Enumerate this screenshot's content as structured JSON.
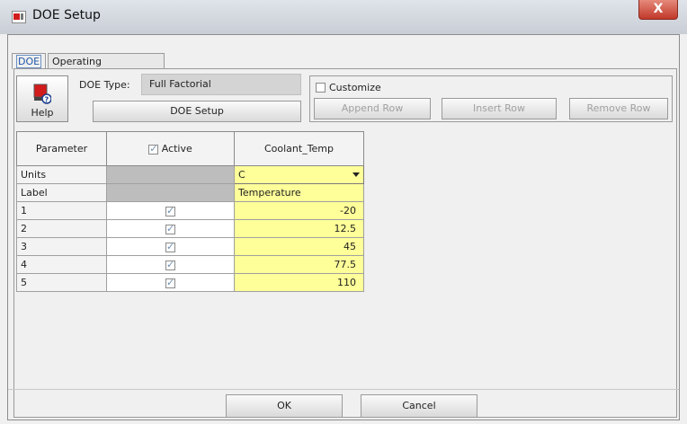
{
  "window": {
    "title": "DOE Setup",
    "close_label": "X"
  },
  "tabs": [
    {
      "label": "DOE",
      "active": true
    },
    {
      "label": "Operating Parameters",
      "active": false
    }
  ],
  "doe": {
    "help_label": "Help",
    "doe_type_label": "DOE Type:",
    "doe_type_value": "Full Factorial",
    "doe_setup_button": "DOE Setup",
    "customize_label": "Customize",
    "customize_checked": false,
    "append_row": "Append Row",
    "insert_row": "Insert Row",
    "remove_row": "Remove Row"
  },
  "table": {
    "headers": {
      "parameter": "Parameter",
      "active": "Active",
      "active_checked": true,
      "variable": "Coolant_Temp"
    },
    "units_row": {
      "label": "Units",
      "value": "C"
    },
    "label_row": {
      "label": "Label",
      "value": "Temperature"
    },
    "rows": [
      {
        "index": "1",
        "active": true,
        "value": "-20"
      },
      {
        "index": "2",
        "active": true,
        "value": "12.5"
      },
      {
        "index": "3",
        "active": true,
        "value": "45"
      },
      {
        "index": "4",
        "active": true,
        "value": "77.5"
      },
      {
        "index": "5",
        "active": true,
        "value": "110"
      }
    ]
  },
  "footer": {
    "ok": "OK",
    "cancel": "Cancel"
  }
}
